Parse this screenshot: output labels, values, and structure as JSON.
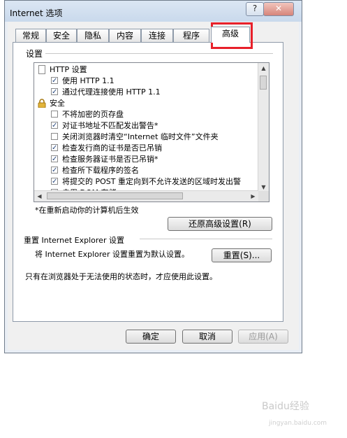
{
  "window": {
    "title": "Internet 选项",
    "help_glyph": "?",
    "close_glyph": "✕"
  },
  "tabs": [
    {
      "label": "常规",
      "active": false
    },
    {
      "label": "安全",
      "active": false
    },
    {
      "label": "隐私",
      "active": false
    },
    {
      "label": "内容",
      "active": false
    },
    {
      "label": "连接",
      "active": false
    },
    {
      "label": "程序",
      "active": false
    },
    {
      "label": "高级",
      "active": true
    }
  ],
  "settings": {
    "group_label": "设置",
    "items": [
      {
        "kind": "header",
        "icon": "page-icon",
        "label": "HTTP 设置"
      },
      {
        "kind": "checkbox",
        "checked": true,
        "label": "使用 HTTP 1.1"
      },
      {
        "kind": "checkbox",
        "checked": true,
        "label": "通过代理连接使用 HTTP 1.1"
      },
      {
        "kind": "header",
        "icon": "lock-icon",
        "label": "安全"
      },
      {
        "kind": "checkbox",
        "checked": false,
        "label": "不将加密的页存盘"
      },
      {
        "kind": "checkbox",
        "checked": true,
        "label": "对证书地址不匹配发出警告*"
      },
      {
        "kind": "checkbox",
        "checked": false,
        "label": "关闭浏览器时清空“Internet 临时文件”文件夹"
      },
      {
        "kind": "checkbox",
        "checked": true,
        "label": "检查发行商的证书是否已吊销"
      },
      {
        "kind": "checkbox",
        "checked": true,
        "label": "检查服务器证书是否已吊销*"
      },
      {
        "kind": "checkbox",
        "checked": true,
        "label": "检查所下载程序的签名"
      },
      {
        "kind": "checkbox",
        "checked": true,
        "label": "将提交的 POST 重定向到不允许发送的区域时发出警"
      },
      {
        "kind": "checkbox",
        "checked": true,
        "label": "启用 DOM 存储"
      }
    ],
    "restart_note": "*在重新启动你的计算机后生效",
    "restore_button": "还原高级设置(R)"
  },
  "reset": {
    "group_label": "重置 Internet Explorer 设置",
    "description": "将 Internet Explorer 设置重置为默认设置。",
    "reset_button": "重置(S)...",
    "note": "只有在浏览器处于无法使用的状态时，才应使用此设置。"
  },
  "footer": {
    "ok": "确定",
    "cancel": "取消",
    "apply": "应用(A)"
  },
  "watermark": {
    "text": "Baidu经验",
    "sub": "jingyan.baidu.com"
  },
  "colors": {
    "highlight": "#e8202a",
    "titlebar": "#c9d9ec"
  }
}
